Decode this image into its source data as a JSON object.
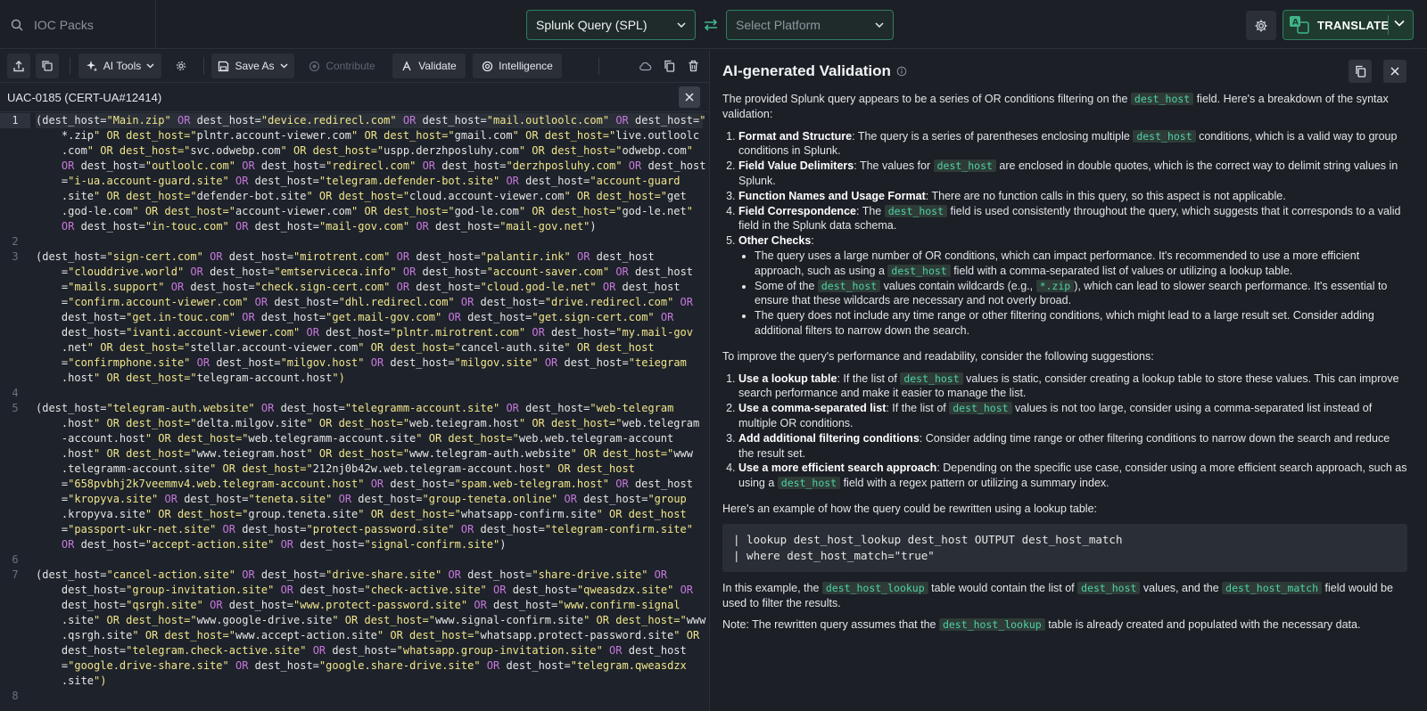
{
  "topbar": {
    "search_placeholder": "IOC Packs",
    "source_language": "Splunk Query (SPL)",
    "target_platform": "Select Platform",
    "translate_label": "TRANSLATE"
  },
  "toolbar": {
    "ai_tools": "AI Tools",
    "save_as": "Save As",
    "contribute": "Contribute",
    "validate": "Validate",
    "intelligence": "Intelligence"
  },
  "file": {
    "name": "UAC-0185 (CERT-UA#12414)"
  },
  "editor": {
    "lines": [
      {
        "n": "1",
        "active": true,
        "rows": [
          "(dest_host=\"Main.zip\" OR dest_host=\"device.redirecl.com\" OR dest_host=\"mail.outloolc.com\" OR dest_host=\"",
          "    *.zip\" OR dest_host=\"plntr.account-viewer.com\" OR dest_host=\"gmail.com\" OR dest_host=\"live.outloolc",
          "    .com\" OR dest_host=\"svc.odwebp.com\" OR dest_host=\"uspp.derzhposluhy.com\" OR dest_host=\"odwebp.com\"",
          "    OR dest_host=\"outloolc.com\" OR dest_host=\"redirecl.com\" OR dest_host=\"derzhposluhy.com\" OR dest_host",
          "    =\"i-ua.account-guard.site\" OR dest_host=\"telegram.defender-bot.site\" OR dest_host=\"account-guard",
          "    .site\" OR dest_host=\"defender-bot.site\" OR dest_host=\"cloud.account-viewer.com\" OR dest_host=\"get",
          "    .god-le.com\" OR dest_host=\"account-viewer.com\" OR dest_host=\"god-le.com\" OR dest_host=\"god-le.net\"",
          "    OR dest_host=\"in-touc.com\" OR dest_host=\"mail-gov.com\" OR dest_host=\"mail-gov.net\")"
        ]
      },
      {
        "n": "2",
        "active": false,
        "rows": [
          ""
        ]
      },
      {
        "n": "3",
        "active": false,
        "rows": [
          "(dest_host=\"sign-cert.com\" OR dest_host=\"mirotrent.com\" OR dest_host=\"palantir.ink\" OR dest_host",
          "    =\"clouddrive.world\" OR dest_host=\"emtserviceca.info\" OR dest_host=\"account-saver.com\" OR dest_host",
          "    =\"mails.support\" OR dest_host=\"check.sign-cert.com\" OR dest_host=\"cloud.god-le.net\" OR dest_host",
          "    =\"confirm.account-viewer.com\" OR dest_host=\"dhl.redirecl.com\" OR dest_host=\"drive.redirecl.com\" OR",
          "    dest_host=\"get.in-touc.com\" OR dest_host=\"get.mail-gov.com\" OR dest_host=\"get.sign-cert.com\" OR",
          "    dest_host=\"ivanti.account-viewer.com\" OR dest_host=\"plntr.mirotrent.com\" OR dest_host=\"my.mail-gov",
          "    .net\" OR dest_host=\"stellar.account-viewer.com\" OR dest_host=\"cancel-auth.site\" OR dest_host",
          "    =\"confirmphone.site\" OR dest_host=\"milgov.host\" OR dest_host=\"milgov.site\" OR dest_host=\"teiegram",
          "    .host\" OR dest_host=\"telegram-account.host\")"
        ]
      },
      {
        "n": "4",
        "active": false,
        "rows": [
          ""
        ]
      },
      {
        "n": "5",
        "active": false,
        "rows": [
          "(dest_host=\"telegram-auth.website\" OR dest_host=\"telegramm-account.site\" OR dest_host=\"web-telegram",
          "    .host\" OR dest_host=\"delta.milgov.site\" OR dest_host=\"web.teiegram.host\" OR dest_host=\"web.telegram",
          "    -account.host\" OR dest_host=\"web.telegramm-account.site\" OR dest_host=\"web.web.telegram-account",
          "    .host\" OR dest_host=\"www.teiegram.host\" OR dest_host=\"www.telegram-auth.website\" OR dest_host=\"www",
          "    .telegramm-account.site\" OR dest_host=\"212nj0b42w.web.telegram-account.host\" OR dest_host",
          "    =\"658pvbhj2k7veemmv4.web.telegram-account.host\" OR dest_host=\"spam.web-telegram.host\" OR dest_host",
          "    =\"kropyva.site\" OR dest_host=\"teneta.site\" OR dest_host=\"group-teneta.online\" OR dest_host=\"group",
          "    .kropyva.site\" OR dest_host=\"group.teneta.site\" OR dest_host=\"whatsapp-confirm.site\" OR dest_host",
          "    =\"passport-ukr-net.site\" OR dest_host=\"protect-password.site\" OR dest_host=\"telegram-confirm.site\"",
          "    OR dest_host=\"accept-action.site\" OR dest_host=\"signal-confirm.site\")"
        ]
      },
      {
        "n": "6",
        "active": false,
        "rows": [
          ""
        ]
      },
      {
        "n": "7",
        "active": false,
        "rows": [
          "(dest_host=\"cancel-action.site\" OR dest_host=\"drive-share.site\" OR dest_host=\"share-drive.site\" OR",
          "    dest_host=\"group-invitation.site\" OR dest_host=\"check-active.site\" OR dest_host=\"qweasdzx.site\" OR",
          "    dest_host=\"qsrgh.site\" OR dest_host=\"www.protect-password.site\" OR dest_host=\"www.confirm-signal",
          "    .site\" OR dest_host=\"www.google-drive.site\" OR dest_host=\"www.signal-confirm.site\" OR dest_host=\"www",
          "    .qsrgh.site\" OR dest_host=\"www.accept-action.site\" OR dest_host=\"whatsapp.protect-password.site\" OR",
          "    dest_host=\"telegram.check-active.site\" OR dest_host=\"whatsapp.group-invitation.site\" OR dest_host",
          "    =\"google.drive-share.site\" OR dest_host=\"google.share-drive.site\" OR dest_host=\"telegram.qweasdzx",
          "    .site\")"
        ]
      },
      {
        "n": "8",
        "active": false,
        "rows": [
          ""
        ]
      }
    ]
  },
  "validation": {
    "title": "AI-generated Validation",
    "intro_a": "The provided Splunk query appears to be a series of OR conditions filtering on the ",
    "intro_b": " field. Here's a breakdown of the syntax validation:",
    "field": "dest_host",
    "checks": [
      {
        "title": "Format and Structure",
        "a": ": The query is a series of parentheses enclosing multiple ",
        "b": " conditions, which is a valid way to group conditions in Splunk."
      },
      {
        "title": "Field Value Delimiters",
        "a": ": The values for ",
        "b": " are enclosed in double quotes, which is the correct way to delimit string values in Splunk."
      },
      {
        "title": "Function Names and Usage Format",
        "a": ": There are no function calls in this query, so this aspect is not applicable.",
        "b": ""
      },
      {
        "title": "Field Correspondence",
        "a": ": The ",
        "b": " field is used consistently throughout the query, which suggests that it corresponds to a valid field in the Splunk data schema."
      },
      {
        "title": "Other Checks",
        "a": ":",
        "b": ""
      }
    ],
    "other_1a": "The query uses a large number of OR conditions, which can impact performance. It's recommended to use a more efficient approach, such as using a ",
    "other_1b": " field with a comma-separated list of values or utilizing a lookup table.",
    "other_2a": "Some of the ",
    "other_2b": " values contain wildcards (e.g., ",
    "wildcard": "*.zip",
    "other_2c": "), which can lead to slower search performance. It's essential to ensure that these wildcards are necessary and not overly broad.",
    "other_3": "The query does not include any time range or other filtering conditions, which might lead to a large result set. Consider adding additional filters to narrow down the search.",
    "suggest_intro": "To improve the query's performance and readability, consider the following suggestions:",
    "suggestions": [
      {
        "title": "Use a lookup table",
        "a": ": If the list of ",
        "b": " values is static, consider creating a lookup table to store these values. This can improve search performance and make it easier to manage the list."
      },
      {
        "title": "Use a comma-separated list",
        "a": ": If the list of ",
        "b": " values is not too large, consider using a comma-separated list instead of multiple OR conditions."
      },
      {
        "title": "Add additional filtering conditions",
        "a": ": Consider adding time range or other filtering conditions to narrow down the search and reduce the result set.",
        "b": ""
      },
      {
        "title": "Use a more efficient search approach",
        "a": ": Depending on the specific use case, consider using a more efficient search approach, such as using a ",
        "b": " field with a regex pattern or utilizing a summary index."
      }
    ],
    "example_intro": "Here's an example of how the query could be rewritten using a lookup table:",
    "example_code": "| lookup dest_host_lookup dest_host OUTPUT dest_host_match\n| where dest_host_match=\"true\"",
    "after_a": "In this example, the ",
    "lookup_tag": "dest_host_lookup",
    "after_b": " table would contain the list of ",
    "after_c": " values, and the ",
    "match_tag": "dest_host_match",
    "after_d": " field would be used to filter the results.",
    "note_a": "Note: The rewritten query assumes that the ",
    "note_b": " table is already created and populated with the necessary data."
  },
  "colors": {
    "accent": "#2e7d64",
    "string": "#f0e68c",
    "operator": "#c678dd",
    "tag_text": "#4fd1a5"
  }
}
